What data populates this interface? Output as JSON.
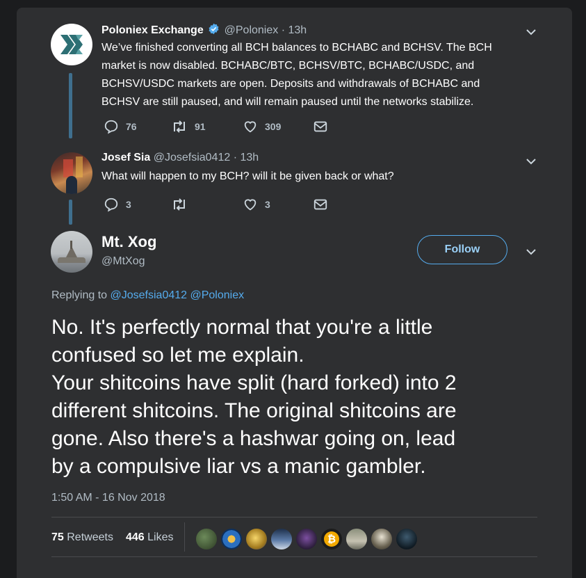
{
  "tweets": [
    {
      "author": "Poloniex Exchange",
      "handle": "@Poloniex",
      "time": "· 13h",
      "text_lines": [
        "We’ve finished converting all BCH balances to BCHABC and BCHSV. The BCH",
        "market is now disabled. BCHABC/BTC, BCHSV/BTC, BCHABC/USDC, and",
        "BCHSV/USDC markets are open. Deposits and withdrawals of BCHABC and",
        "BCHSV are still paused, and will remain paused until the networks stabilize."
      ],
      "replies": "76",
      "retweets": "91",
      "likes": "309"
    },
    {
      "author": "Josef Sia",
      "handle": "@Josefsia0412",
      "time": "· 13h",
      "text_lines": [
        "What will happen to my BCH? will it be given back or what?"
      ],
      "replies": "3",
      "retweets": "",
      "likes": "3"
    }
  ],
  "main": {
    "author": "Mt. Xog",
    "handle": "@MtXog",
    "follow_label": "Follow",
    "replying_prefix": "Replying to",
    "replying_to": [
      "@Josefsia0412",
      "@Poloniex"
    ],
    "text_lines": [
      "No. It's perfectly normal that you're a little",
      "confused so let me explain.",
      "Your shitcoins have split (hard forked) into 2",
      "different shitcoins. The original shitcoins are",
      "gone. Also there's a hashwar going on, lead",
      "by a compulsive liar vs a manic gambler."
    ],
    "timestamp": "1:50 AM - 16 Nov 2018",
    "retweet_count": "75",
    "retweet_label": "Retweets",
    "like_count": "446",
    "like_label": "Likes"
  },
  "icons": {
    "reply": "reply-icon",
    "retweet": "retweet-icon",
    "like": "heart-icon",
    "dm": "envelope-icon",
    "more": "chevron-down-icon",
    "verified": "verified-badge-icon"
  },
  "colors": {
    "background": "#1b1c1e",
    "card": "#2e2f31",
    "accent": "#55acee",
    "thread_line": "#3f6f8e",
    "muted": "#b1bcc5"
  }
}
